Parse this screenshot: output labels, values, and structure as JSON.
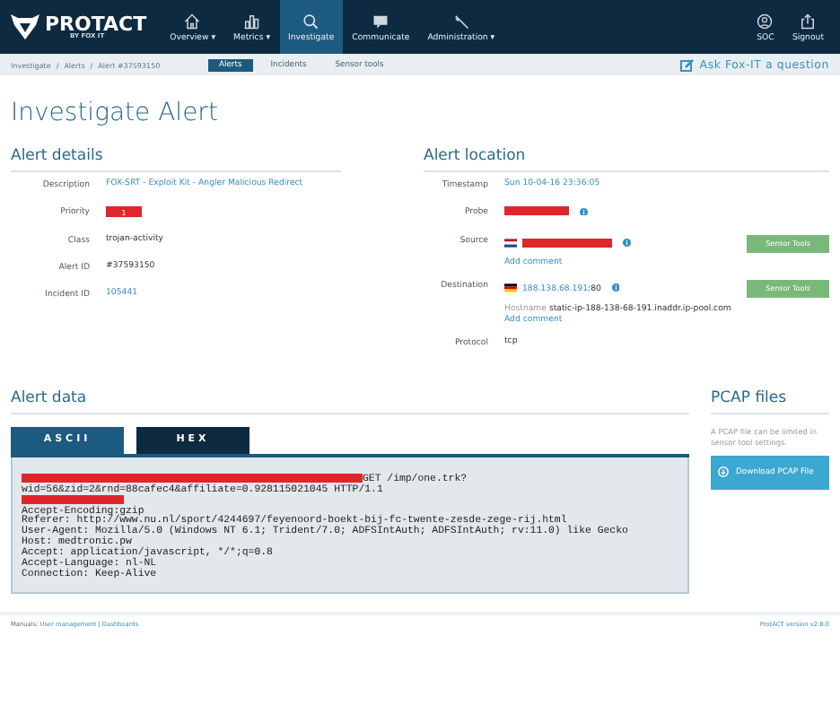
{
  "header": {
    "brand": "PROTACT",
    "brand_sub": "BY FOX IT",
    "nav": [
      {
        "label": "Overview",
        "caret": "▾",
        "selected": false
      },
      {
        "label": "Metrics",
        "caret": "▾",
        "selected": false
      },
      {
        "label": "Investigate",
        "selected": true
      },
      {
        "label": "Communicate",
        "selected": false
      },
      {
        "label": "Administration",
        "caret": "▾",
        "selected": false
      }
    ],
    "right_nav": [
      {
        "label": "SOC"
      },
      {
        "label": "Signout"
      }
    ]
  },
  "subbar": {
    "breadcrumb": [
      "Investigate",
      "Alerts",
      "Alert #37593150"
    ],
    "separator": "/",
    "tabs": [
      {
        "label": "Alerts",
        "selected": true
      },
      {
        "label": "Incidents",
        "selected": false
      },
      {
        "label": "Sensor tools",
        "selected": false
      }
    ],
    "ask": "Ask Fox-IT a question"
  },
  "title": "Investigate Alert",
  "alert_details": {
    "heading": "Alert details",
    "rows": [
      {
        "label": "Description",
        "kind": "link",
        "value": "FOX-SRT - Exploit Kit - Angler Malicious Redirect"
      },
      {
        "label": "Priority",
        "kind": "badge",
        "value": "1",
        "color": "#e0262a"
      },
      {
        "label": "Class",
        "kind": "text",
        "value": "trojan-activity"
      },
      {
        "label": "Alert ID",
        "kind": "text",
        "value": "#37593150"
      },
      {
        "label": "Incident ID",
        "kind": "link",
        "value": "105441"
      }
    ]
  },
  "alert_location": {
    "heading": "Alert location",
    "rows": [
      {
        "label": "Timestamp",
        "kind": "link",
        "value": "Sun 10-04-16 23:36:05"
      },
      {
        "label": "Probe",
        "kind": "redacted",
        "info": true
      },
      {
        "label": "Source",
        "kind": "redacted",
        "info": true,
        "button": "Sensor Tools",
        "comment": "Add comment"
      },
      {
        "label": "Destination",
        "kind": "address",
        "value": "188.138.68.191",
        "port": ":80",
        "info": true,
        "button": "Sensor Tools",
        "hostname_label": "Hostname",
        "hostname": "static-ip-188-138-68-191.inaddr.ip-pool.com",
        "comment": "Add comment"
      },
      {
        "label": "Protocol",
        "kind": "text",
        "value": "tcp"
      }
    ]
  },
  "alert_data": {
    "heading": "Alert data",
    "tabs": [
      {
        "label": "ASCII",
        "selected": true
      },
      {
        "label": "HEX",
        "selected": false
      }
    ],
    "lines": [
      {
        "redacted": true,
        "text": "GET /imp/one.trk?"
      },
      {
        "text": "wid=56&zid=2&rnd=88cafec4&affiliate=0.928115021045 HTTP/1.1"
      },
      {
        "redacted": true
      },
      {
        "text": "Accept-Encoding:gzip"
      },
      {
        "text": "Referer: http://www.nu.nl/sport/4244697/feyenoord-boekt-bij-fc-twente-zesde-zege-rij.html"
      },
      {
        "text": "User-Agent: Mozilla/5.0 (Windows NT 6.1; Trident/7.0; ADFSIntAuth; ADFSIntAuth; rv:11.0) like Gecko"
      },
      {
        "text": "Host: medtronic.pw"
      },
      {
        "text": "Accept: application/javascript, */*;q=0.8"
      },
      {
        "text": "Accept-Language: nl-NL"
      },
      {
        "text": "Connection: Keep-Alive"
      }
    ]
  },
  "pcap": {
    "heading": "PCAP files",
    "note": "A PCAP file can be limited in sensor tool settings.",
    "button": "Download PCAP File"
  },
  "footer": {
    "manuals_label": "Manuals:",
    "links": [
      "User management",
      "Dashboards"
    ],
    "separator": "|",
    "version": "ProtACT version v2.8.0"
  }
}
